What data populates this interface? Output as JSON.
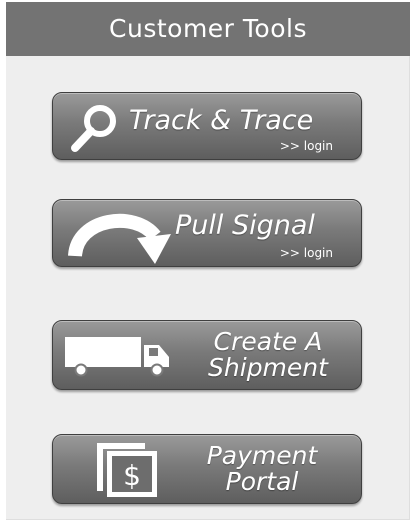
{
  "panel": {
    "title": "Customer Tools"
  },
  "buttons": {
    "track": {
      "label": "Track & Trace",
      "sub": ">> login",
      "icon": "search-icon"
    },
    "pull": {
      "label": "Pull Signal",
      "sub": ">> login",
      "icon": "curved-arrow-icon"
    },
    "create": {
      "line1": "Create A",
      "line2": "Shipment",
      "icon": "truck-icon"
    },
    "payment": {
      "line1": "Payment",
      "line2": "Portal",
      "icon": "dollar-document-icon"
    }
  },
  "colors": {
    "header_bg": "#737373",
    "panel_bg": "#eeeeee",
    "button_top": "#9a9a9a",
    "button_bottom": "#5e5e5e",
    "text": "#ffffff"
  }
}
